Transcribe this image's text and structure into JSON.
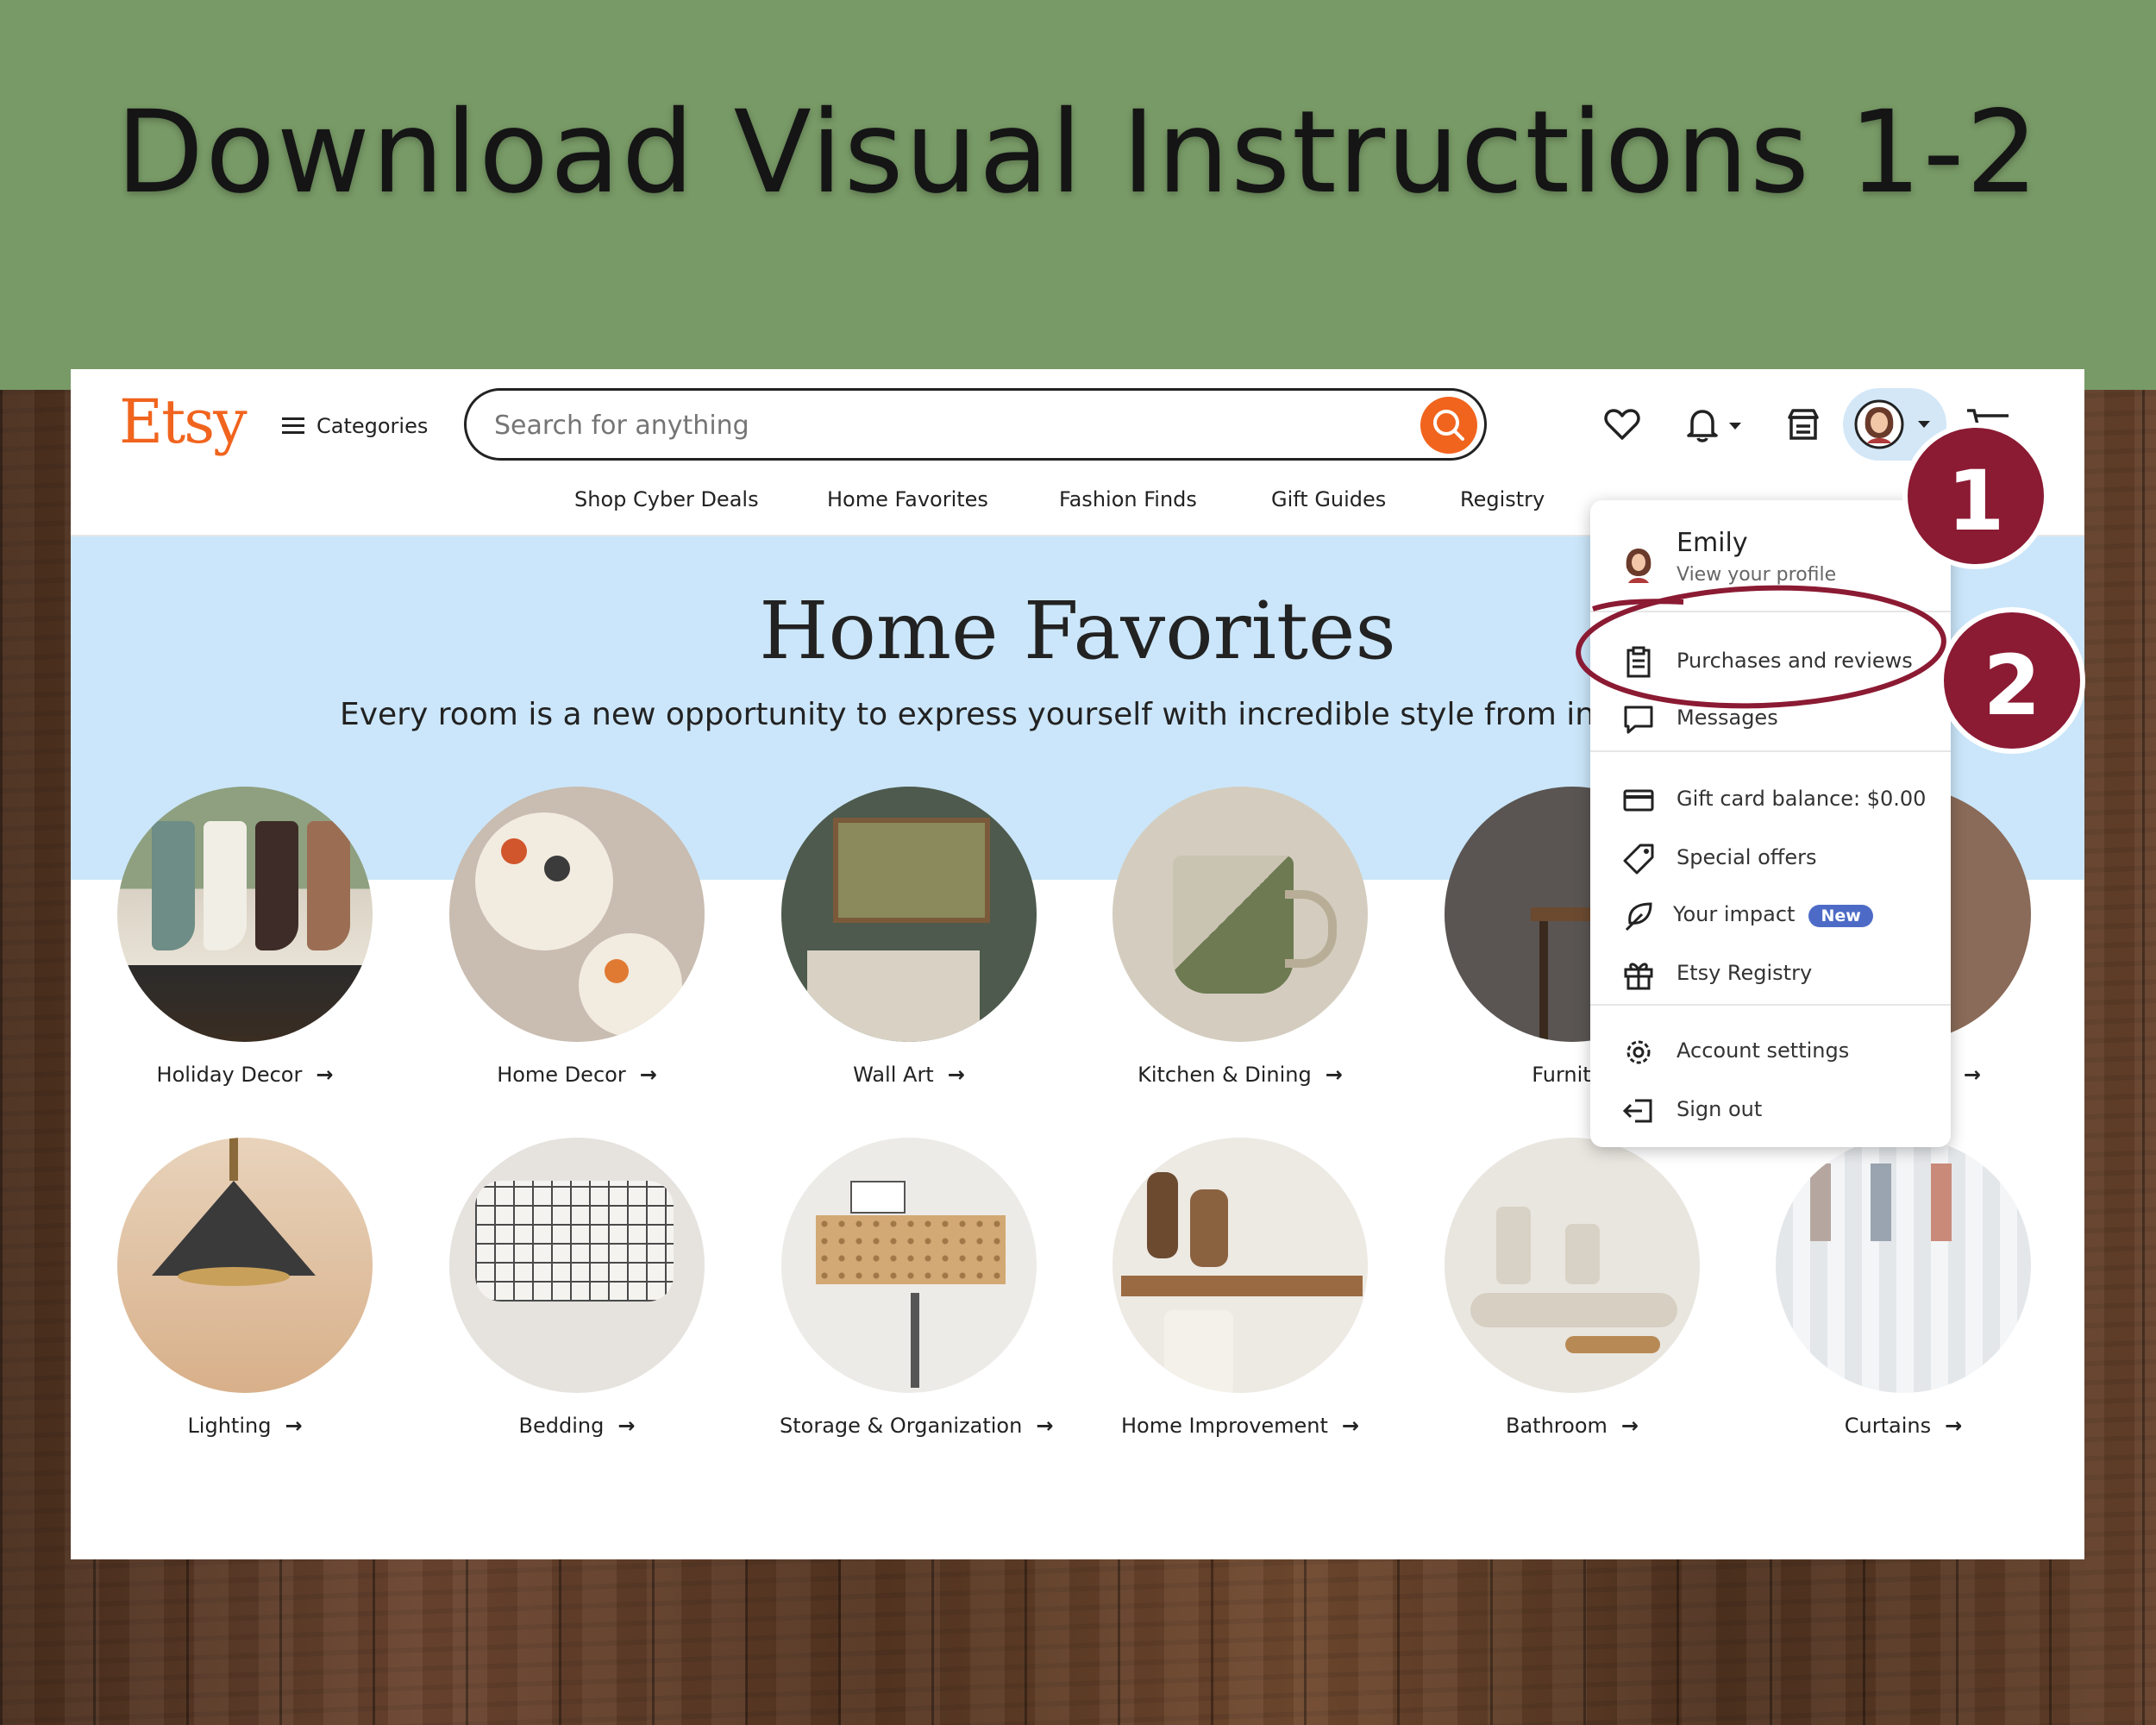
{
  "banner": {
    "title": "Download Visual Instructions 1-2"
  },
  "header": {
    "logo": "Etsy",
    "categories_label": "Categories",
    "search_placeholder": "Search for anything"
  },
  "subnav": [
    "Shop Cyber Deals",
    "Home Favorites",
    "Fashion Finds",
    "Gift Guides",
    "Registry"
  ],
  "hero": {
    "title": "Home Favorites",
    "subtitle": "Every room is a new opportunity to express yourself with incredible style from incr"
  },
  "categories_row1": [
    "Holiday Decor",
    "Home Decor",
    "Wall Art",
    "Kitchen & Dining",
    "Furnitur"
  ],
  "categories_row2": [
    "Lighting",
    "Bedding",
    "Storage & Organization",
    "Home Improvement",
    "Bathroom",
    "Curtains"
  ],
  "menu": {
    "user_name": "Emily",
    "user_sub": "View your profile",
    "purchases": "Purchases and reviews",
    "messages": "Messages",
    "gift_card": "Gift card balance: $0.00",
    "special_offers": "Special offers",
    "impact": "Your impact",
    "impact_badge": "New",
    "registry": "Etsy Registry",
    "account_settings": "Account settings",
    "sign_out": "Sign out"
  },
  "annotations": {
    "step1": "1",
    "step2": "2"
  },
  "colors": {
    "banner": "#789a66",
    "etsy_orange": "#f1641e",
    "hero_bg": "#cbe6fa",
    "annotation": "#8b1a33",
    "badge": "#4d6bc6"
  }
}
